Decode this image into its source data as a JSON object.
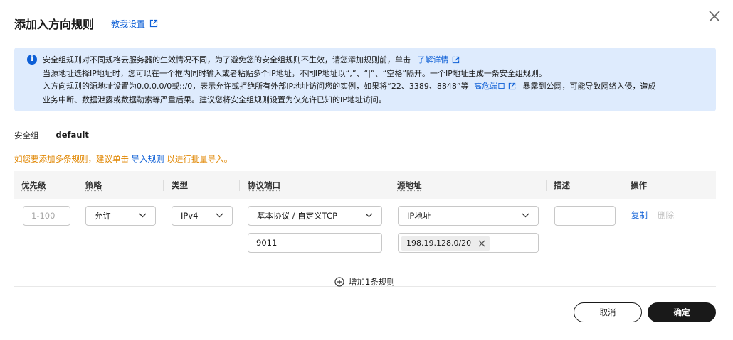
{
  "dialog": {
    "title": "添加入方向规则",
    "help_link": "教我设置"
  },
  "info": {
    "line1_text": "安全组规则对不同规格云服务器的生效情况不同，为了避免您的安全组规则不生效，请您添加规则前，单击",
    "line1_link": "了解详情",
    "line2_text": "当源地址选择IP地址时，您可以在一个框内同时输入或者粘贴多个IP地址，不同IP地址以“,”、“|”、“空格”隔开。一个IP地址生成一条安全组规则。",
    "line3_text": "入方向规则的源地址设置为0.0.0.0/0或::/0，表示允许或拒绝所有外部IP地址访问您的实例，如果将“22、3389、8848”等",
    "line3_link": "高危端口",
    "line3_after": "暴露到公网，可能导致网络入侵，造成",
    "line4_text": "业务中断、数据泄露或数据勒索等严重后果。建议您将安全组规则设置为仅允许已知的IP地址访问。"
  },
  "security_group": {
    "label": "安全组",
    "value": "default"
  },
  "tip": {
    "before": "如您要添加多条规则，建议单击",
    "link": "导入规则",
    "after": "以进行批量导入。"
  },
  "table": {
    "columns": [
      "优先级",
      "策略",
      "类型",
      "协议端口",
      "源地址",
      "描述",
      "操作"
    ],
    "row": {
      "priority_placeholder": "1-100",
      "policy": "允许",
      "type": "IPv4",
      "protocol": "基本协议 / 自定义TCP",
      "port": "9011",
      "source_type": "IP地址",
      "source_tag": "198.19.128.0/20",
      "description": "",
      "op_copy": "复制",
      "op_delete": "删除"
    }
  },
  "add_rule": "增加1条规则",
  "buttons": {
    "cancel": "取消",
    "confirm": "确定"
  },
  "colors": {
    "link": "#0d5fd6",
    "tip": "#e08600",
    "info_bg": "#deebfd",
    "primary_button": "#191919"
  }
}
